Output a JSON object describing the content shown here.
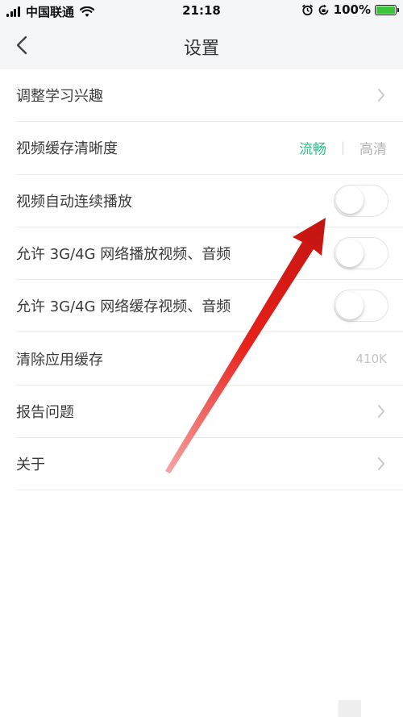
{
  "status_bar": {
    "carrier": "中国联通",
    "time": "21:18",
    "battery_percent": "100%",
    "battery_level": 1.0,
    "icons": [
      "signal-icon",
      "wifi-icon",
      "alarm-icon",
      "orientation-lock-icon",
      "battery-icon"
    ]
  },
  "nav": {
    "title": "设置",
    "back_icon": "chevron-left-icon"
  },
  "settings": {
    "rows": [
      {
        "label": "调整学习兴趣"
      },
      {
        "label": "视频缓存清晰度",
        "options": [
          "流畅",
          "高清"
        ],
        "selected": "流畅"
      },
      {
        "label": "视频自动连续播放",
        "toggle": false
      },
      {
        "label": "允许 3G/4G 网络播放视频、音频",
        "toggle": false
      },
      {
        "label": "允许 3G/4G 网络缓存视频、音频",
        "toggle": false
      },
      {
        "label": "清除应用缓存",
        "value": "410K"
      },
      {
        "label": "报告问题"
      },
      {
        "label": "关于"
      }
    ]
  },
  "colors": {
    "accent": "#2dc085",
    "annotation_arrow": "#e8211b",
    "battery": "#3cc43c"
  }
}
